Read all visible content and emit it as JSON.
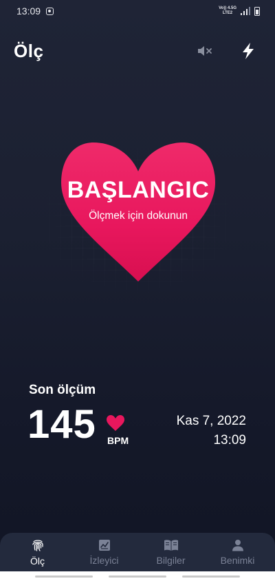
{
  "status_bar": {
    "time": "13:09",
    "network_top": "Vo)) 4.5G",
    "network_bottom": "LTE2"
  },
  "header": {
    "title": "Ölç",
    "icons": [
      "mute-icon",
      "flash-icon"
    ]
  },
  "start_button": {
    "title": "BAŞLANGIC",
    "subtitle": "Ölçmek için dokunun",
    "color": "#e8175d"
  },
  "last_measurement": {
    "label": "Son ölçüm",
    "value": "145",
    "unit": "BPM",
    "date": "Kas 7, 2022",
    "time": "13:09"
  },
  "bottom_nav": {
    "items": [
      {
        "label": "Ölç",
        "icon": "fingerprint-icon",
        "active": true
      },
      {
        "label": "İzleyici",
        "icon": "chart-icon",
        "active": false
      },
      {
        "label": "Bilgiler",
        "icon": "book-icon",
        "active": false
      },
      {
        "label": "Benimki",
        "icon": "person-icon",
        "active": false
      }
    ]
  },
  "colors": {
    "background": "#1b2031",
    "accent": "#e8175d",
    "nav_background": "#232a3d",
    "nav_inactive": "#7b8296"
  }
}
